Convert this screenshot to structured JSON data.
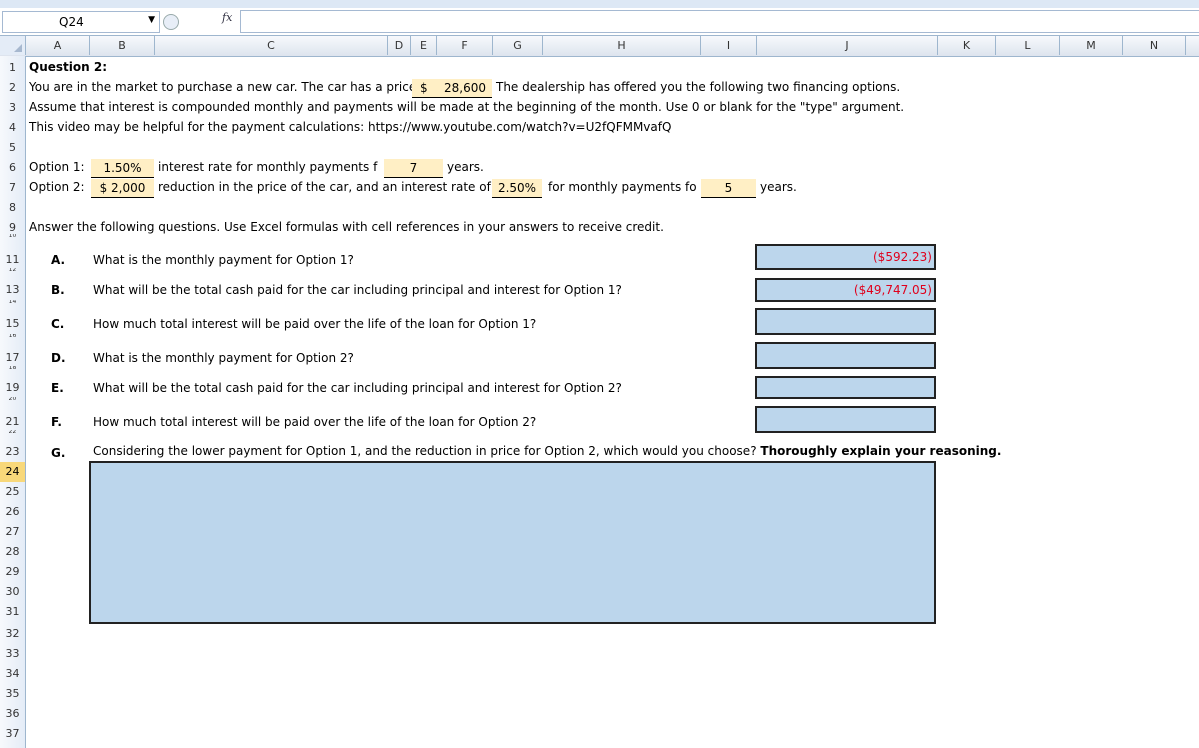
{
  "formula_bar": {
    "name_box": "Q24",
    "fx": "fx"
  },
  "columns": [
    "A",
    "B",
    "C",
    "D",
    "E",
    "F",
    "G",
    "H",
    "I",
    "J",
    "K",
    "L",
    "M",
    "N"
  ],
  "rows": [
    "1",
    "2",
    "3",
    "4",
    "5",
    "6",
    "7",
    "8",
    "9",
    "10",
    "11",
    "12",
    "13",
    "14",
    "15",
    "16",
    "17",
    "18",
    "19",
    "20",
    "21",
    "22",
    "23",
    "24",
    "25",
    "26",
    "27",
    "28",
    "29",
    "30",
    "31",
    "32",
    "33",
    "34",
    "35",
    "36",
    "37"
  ],
  "selected_row": "24",
  "sheet": {
    "r1": "Question 2:",
    "r2a": "You are in the market to purchase a new car. The car has a price",
    "r2_price_symbol": "$",
    "r2_price": "28,600",
    "r2b": "The dealership has offered you the following two financing options.",
    "r3": "Assume that interest is compounded monthly and payments will be made at the beginning of the month. Use 0 or blank for the \"type\" argument.",
    "r4": "This video may be helpful for the payment calculations: https://www.youtube.com/watch?v=U2fQFMMvafQ",
    "opt1_label": "Option 1:",
    "opt1_rate": "1.50%",
    "opt1_text": "interest rate for monthly payments f",
    "opt1_years": "7",
    "opt1_years_label": "years.",
    "opt2_label": "Option 2:",
    "opt2_reduction": "$  2,000",
    "opt2_text": "reduction in the price of the car, and an interest rate of",
    "opt2_rate": "2.50%",
    "opt2_text2": "for monthly payments fo",
    "opt2_years": "5",
    "opt2_years_label": "years.",
    "r9": "Answer the following questions. Use Excel formulas with cell references in your answers to receive credit."
  },
  "questions": [
    {
      "letter": "A.",
      "text": "What is the monthly payment for Option 1?",
      "answer": "($592.23)"
    },
    {
      "letter": "B.",
      "text": "What will be the total cash paid for the car including principal and interest for Option 1?",
      "answer": "($49,747.05)"
    },
    {
      "letter": "C.",
      "text": "How much total interest will be paid over the life of the loan for Option 1?",
      "answer": ""
    },
    {
      "letter": "D.",
      "text": "What is the monthly payment for Option 2?",
      "answer": ""
    },
    {
      "letter": "E.",
      "text": "What will be the total cash paid for the car including principal and interest for Option 2?",
      "answer": ""
    },
    {
      "letter": "F.",
      "text": "How much total interest will be paid over the life of the loan for Option 2?",
      "answer": ""
    }
  ],
  "question_g": {
    "letter": "G.",
    "text": "Considering the lower payment for Option 1, and the reduction in price for Option 2, which would you choose?",
    "bold": "Thoroughly explain your reasoning."
  }
}
